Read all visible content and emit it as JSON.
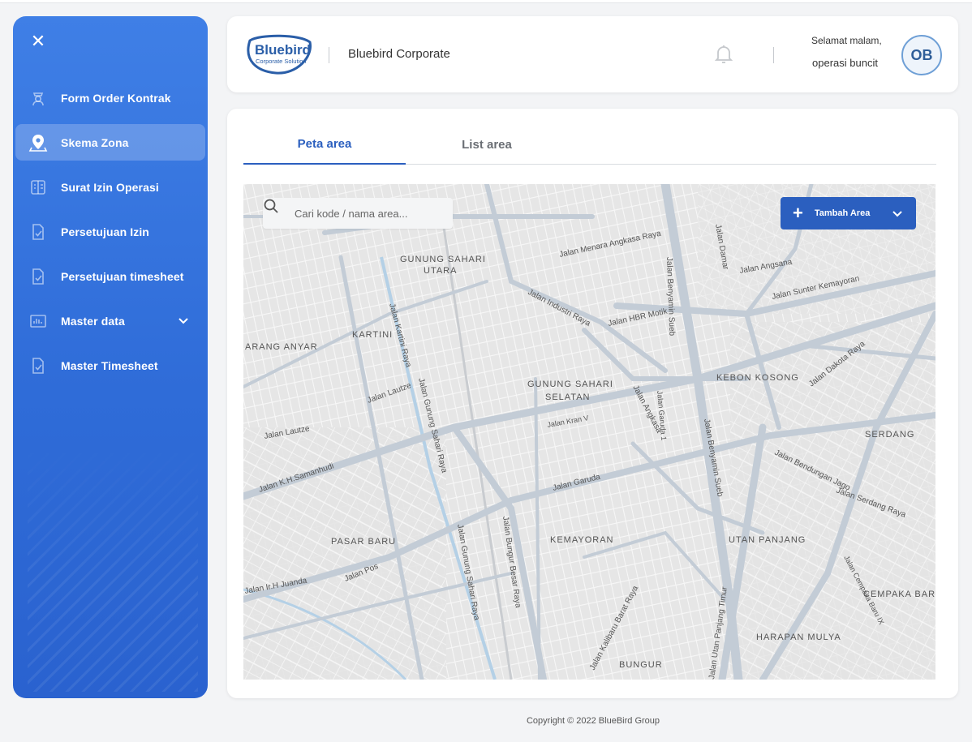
{
  "sidebar": {
    "close_icon": "close-icon",
    "items": [
      {
        "label": "Form Order Kontrak",
        "icon": "driver-icon",
        "active": false
      },
      {
        "label": "Skema Zona",
        "icon": "map-pin-icon",
        "active": true
      },
      {
        "label": "Surat Izin Operasi",
        "icon": "document-icon",
        "active": false
      },
      {
        "label": "Persetujuan Izin",
        "icon": "document-check-icon",
        "active": false
      },
      {
        "label": "Persetujuan timesheet",
        "icon": "document-check-icon",
        "active": false
      },
      {
        "label": "Master data",
        "icon": "chart-icon",
        "active": false,
        "has_dropdown": true
      },
      {
        "label": "Master Timesheet",
        "icon": "document-check-icon",
        "active": false
      }
    ]
  },
  "header": {
    "logo_text": "Bluebird",
    "logo_subtext": "Corporate Solution",
    "company": "Bluebird Corporate",
    "greeting": "Selamat malam,",
    "username": "operasi buncit",
    "avatar_initials": "OB"
  },
  "tabs": [
    {
      "label": "Peta area",
      "active": true
    },
    {
      "label": "List area",
      "active": false
    }
  ],
  "map": {
    "search_placeholder": "Cari kode / nama area...",
    "add_button_label": "Tambah Area",
    "labels": {
      "gunung_sahari_utara": "GUNUNG SAHARI",
      "gunung_sahari_utara_2": "UTARA",
      "kartini": "KARTINI",
      "karang_anyar": "ARANG ANYAR",
      "gunung_sahari_selatan": "GUNUNG SAHARI",
      "gunung_sahari_selatan_2": "SELATAN",
      "kebon_kosong": "KEBON KOSONG",
      "serdang": "SERDANG",
      "pasar_baru": "PASAR BARU",
      "kemayoran": "KEMAYORAN",
      "utan_panjang": "UTAN PANJANG",
      "cempaka_baru": "CEMPAKA BARU",
      "harapan_mulya": "HARAPAN MULYA",
      "bungur": "BUNGUR",
      "jl_menara": "Jalan Menara Angkasa Raya",
      "jl_angsana": "Jalan Angsana",
      "jl_sunter": "Jalan Sunter Kemayoran",
      "jl_hbr": "Jalan HBR Motik",
      "jl_industri": "Jalan Industri Raya",
      "jl_garuda": "Jalan Garuda",
      "jl_samanhudi": "Jalan K.H.Samanhudi",
      "jl_lautze": "Jalan Lautze",
      "jl_lautze2": "Jalan Lautze",
      "jl_pos": "Jalan Pos",
      "jl_juanda": "Jalan Ir.H Juanda",
      "jl_bendungan": "Jalan Bendungan Jago",
      "jl_serdang": "Jalan Serdang Raya",
      "jl_benyamin": "Jalan Benyamin Sueb",
      "jl_benyamin2": "Jalan Benyamin Sueb",
      "jl_dakota": "Jalan Dakota Raya",
      "jl_angkasa": "Jalan Angkasa",
      "jl_kartini": "Jalan Kartini Raya",
      "jl_gunung_sahari": "Jalan Gunung Sahari Raya",
      "jl_gunung_sahari2": "Jalan Gunung Sahari Raya",
      "jl_bungur": "Jalan Bungur Besar Raya",
      "jl_kalibaru": "Jalan Kalibaru Barat Raya",
      "jl_utan_panjang": "Jalan Utan Panjang Timur",
      "jl_cempaka": "Jalan Cempaka Baru IX",
      "jl_damar": "Jalan Damar",
      "jl_garuda1": "Jalan Garuda 1",
      "jl_kran": "Jalan Kran V"
    }
  },
  "footer": {
    "copyright": "Copyright © 2022 BlueBird Group"
  },
  "colors": {
    "primary": "#2b5fbf",
    "sidebar_top": "#3f7fe6",
    "sidebar_bottom": "#2a62cf"
  }
}
